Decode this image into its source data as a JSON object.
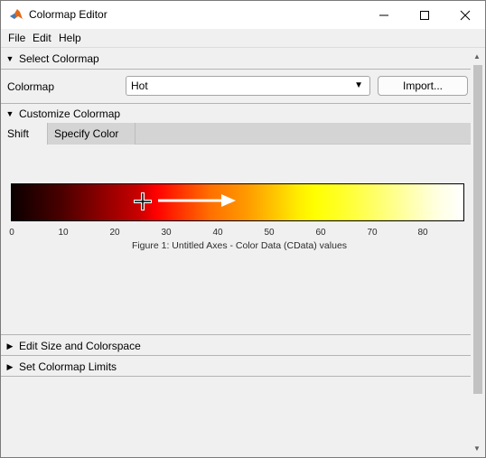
{
  "window": {
    "title": "Colormap Editor",
    "minimize_glyph": "—",
    "maximize_glyph": "☐",
    "close_glyph": "✕"
  },
  "menu": {
    "file": "File",
    "edit": "Edit",
    "help": "Help"
  },
  "select_colormap": {
    "header": "Select Colormap",
    "colormap_label": "Colormap",
    "colormap_value": "Hot",
    "import_button": "Import..."
  },
  "customize": {
    "header": "Customize Colormap",
    "tabs": [
      {
        "label": "Shift",
        "active": true
      },
      {
        "label": "Specify Color",
        "active": false
      }
    ]
  },
  "axes": {
    "caption": "Figure 1: Untitled Axes - Color Data (CData) values",
    "ticks": [
      "0",
      "10",
      "20",
      "30",
      "40",
      "50",
      "60",
      "70",
      "80"
    ]
  },
  "sections": {
    "edit_size": "Edit Size and Colorspace",
    "set_limits": "Set Colormap Limits"
  },
  "icons": {
    "collapse": "▼",
    "expand": "▶",
    "dropdown_arrow": "▼",
    "scroll_up": "▲",
    "scroll_down": "▼"
  }
}
